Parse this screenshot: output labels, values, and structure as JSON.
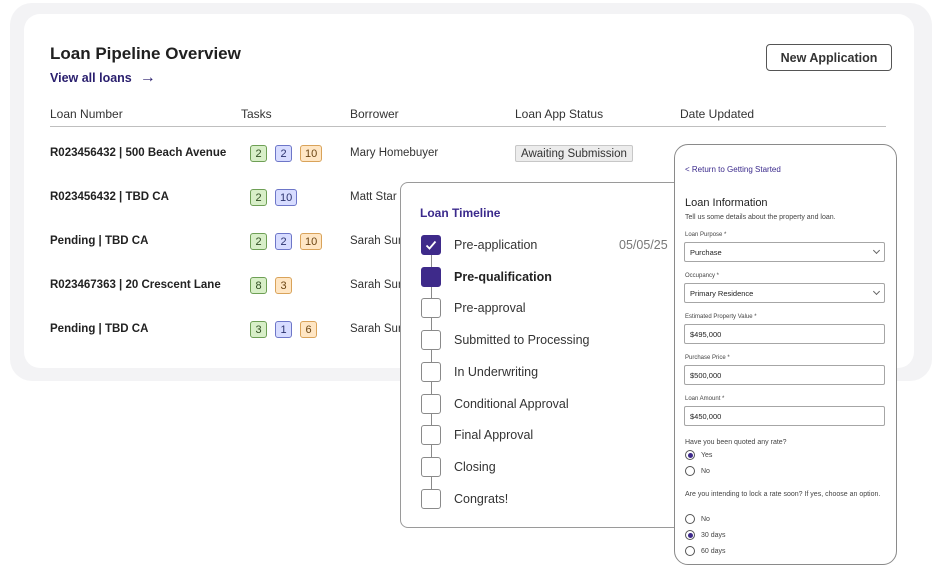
{
  "header": {
    "title": "Loan Pipeline Overview",
    "view_all": "View all loans",
    "arrow_glyph": "→",
    "new_application": "New Application"
  },
  "table": {
    "columns": [
      "Loan Number",
      "Tasks",
      "Borrower",
      "Loan App Status",
      "Date Updated"
    ],
    "rows": [
      {
        "loan": "R023456432 | 500 Beach Avenue",
        "tasks": [
          {
            "v": "2",
            "c": "green"
          },
          {
            "v": "2",
            "c": "blue"
          },
          {
            "v": "10",
            "c": "orange"
          }
        ],
        "borrower": "Mary Homebuyer",
        "status": "Awaiting Submission"
      },
      {
        "loan": "R023456432 | TBD CA",
        "tasks": [
          {
            "v": "2",
            "c": "green"
          },
          {
            "v": "10",
            "c": "blue"
          }
        ],
        "borrower": "Matt Star",
        "status": ""
      },
      {
        "loan": "Pending | TBD CA",
        "tasks": [
          {
            "v": "2",
            "c": "green"
          },
          {
            "v": "2",
            "c": "blue"
          },
          {
            "v": "10",
            "c": "orange"
          }
        ],
        "borrower": "Sarah Sur",
        "status": ""
      },
      {
        "loan": "R023467363 | 20 Crescent Lane",
        "tasks": [
          {
            "v": "8",
            "c": "green"
          },
          {
            "v": "3",
            "c": "orange"
          }
        ],
        "borrower": "Sarah Sur",
        "status": ""
      },
      {
        "loan": "Pending | TBD CA",
        "tasks": [
          {
            "v": "3",
            "c": "green"
          },
          {
            "v": "1",
            "c": "blue"
          },
          {
            "v": "6",
            "c": "orange"
          }
        ],
        "borrower": "Sarah Sur",
        "status": ""
      }
    ]
  },
  "timeline": {
    "title": "Loan Timeline",
    "date": "05/05/25",
    "steps": [
      {
        "label": "Pre-application",
        "state": "checked"
      },
      {
        "label": "Pre-qualification",
        "state": "current"
      },
      {
        "label": "Pre-approval",
        "state": "todo"
      },
      {
        "label": "Submitted to Processing",
        "state": "todo"
      },
      {
        "label": "In Underwriting",
        "state": "todo"
      },
      {
        "label": "Conditional Approval",
        "state": "todo"
      },
      {
        "label": "Final Approval",
        "state": "todo"
      },
      {
        "label": "Closing",
        "state": "todo"
      },
      {
        "label": "Congrats!",
        "state": "todo"
      }
    ]
  },
  "phone": {
    "back": "< Return to Getting Started",
    "title": "Loan Information",
    "subtitle": "Tell us some details about the property and loan.",
    "fields": [
      {
        "label": "Loan Purpose *",
        "value": "Purchase",
        "select": true
      },
      {
        "label": "Occupancy *",
        "value": "Primary Residence",
        "select": true
      },
      {
        "label": "Estimated Property Value *",
        "value": "$495,000",
        "select": false
      },
      {
        "label": "Purchase Price *",
        "value": "$500,000",
        "select": false
      },
      {
        "label": "Loan Amount *",
        "value": "$450,000",
        "select": false
      }
    ],
    "q1": "Have you been quoted any rate?",
    "q1_options": [
      {
        "label": "Yes",
        "checked": true
      },
      {
        "label": "No",
        "checked": false
      }
    ],
    "q2": "Are you intending to lock a rate soon? If yes, choose an option.",
    "q2_options": [
      {
        "label": "No",
        "checked": false
      },
      {
        "label": "30 days",
        "checked": true
      },
      {
        "label": "60 days",
        "checked": false
      }
    ]
  },
  "colors": {
    "accent": "#3e2a8a",
    "badge_green": "#d8efc8",
    "badge_blue": "#d7dcff",
    "badge_orange": "#ffe6c4"
  }
}
